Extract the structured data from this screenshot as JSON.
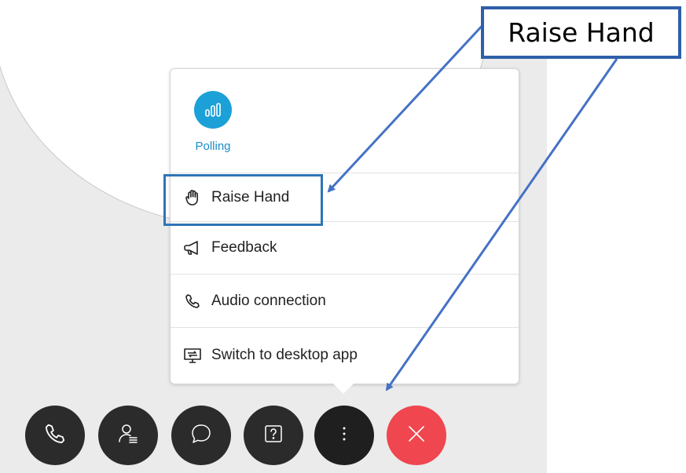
{
  "menu": {
    "polling": {
      "label": "Polling",
      "icon": "poll-chart-icon"
    },
    "items": [
      {
        "label": "Raise Hand",
        "icon": "hand-icon"
      },
      {
        "label": "Feedback",
        "icon": "megaphone-icon"
      },
      {
        "label": "Audio connection",
        "icon": "phone-icon"
      },
      {
        "label": "Switch to desktop app",
        "icon": "desktop-switch-icon"
      }
    ]
  },
  "toolbar": {
    "buttons": [
      {
        "name": "audio",
        "icon": "phone-icon"
      },
      {
        "name": "participants",
        "icon": "participants-icon"
      },
      {
        "name": "chat",
        "icon": "chat-icon"
      },
      {
        "name": "qa",
        "icon": "question-icon"
      },
      {
        "name": "more",
        "icon": "more-icon"
      },
      {
        "name": "leave",
        "icon": "close-icon"
      }
    ]
  },
  "annotation": {
    "callout_text": "Raise Hand"
  },
  "colors": {
    "accent": "#1ba0d7",
    "end_button": "#f0464f",
    "toolbar_button": "#2b2b2b",
    "annotation_blue": "#2e75b6"
  }
}
